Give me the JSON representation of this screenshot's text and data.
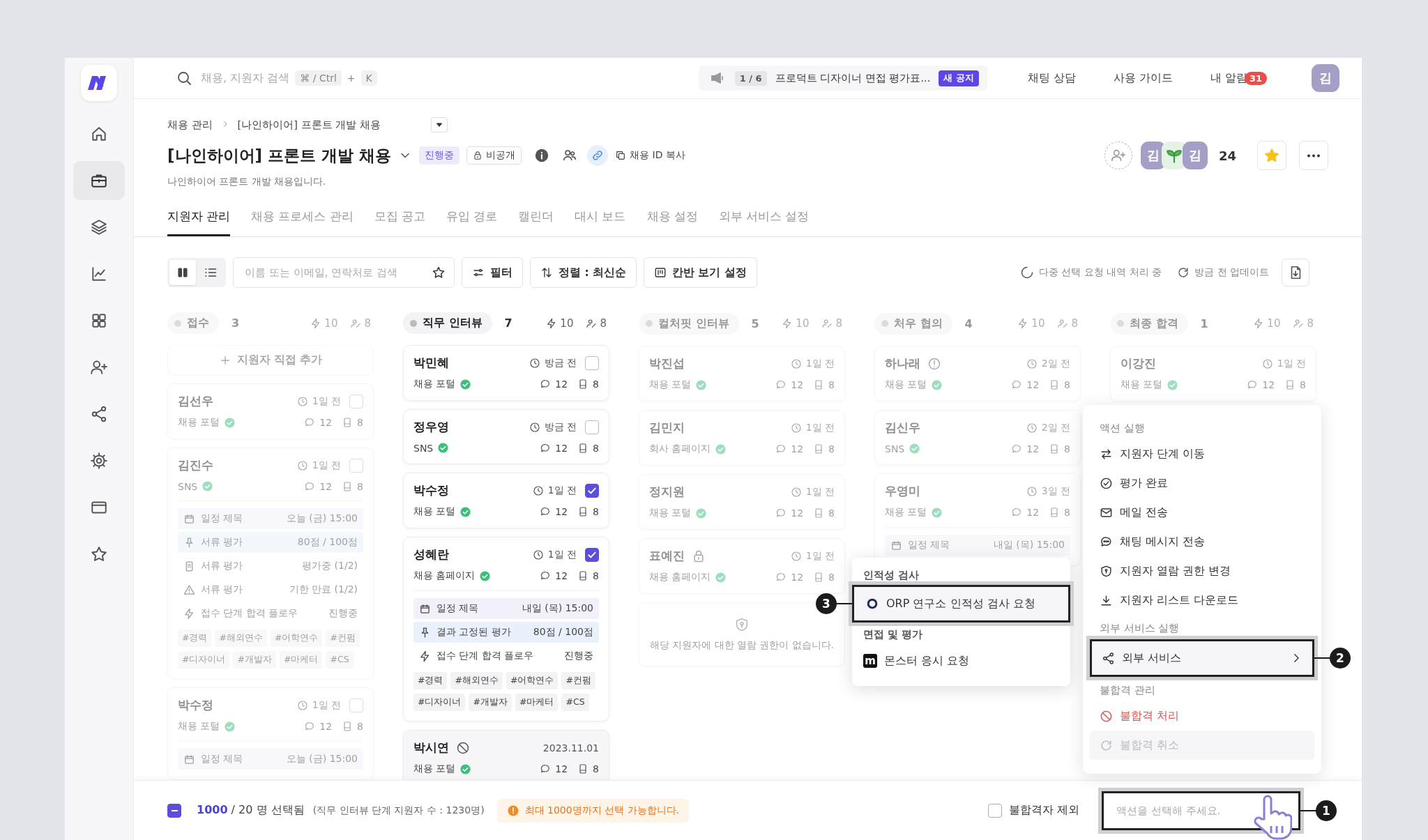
{
  "sidebar": {
    "items": [
      {
        "selected": false
      },
      {
        "selected": true
      },
      {
        "selected": false
      },
      {
        "selected": false
      },
      {
        "selected": false
      },
      {
        "selected": false
      },
      {
        "selected": false
      },
      {
        "selected": false
      },
      {
        "selected": false
      },
      {
        "selected": false
      }
    ]
  },
  "topbar": {
    "search_placeholder": "채용, 지원자 검색",
    "shortcut": [
      "⌘ / Ctrl",
      "+",
      "K"
    ],
    "notice": {
      "counter": "1 / 6",
      "text": "프로덕트 디자이너 면접 평가표...",
      "badge": "새 공지"
    },
    "links": [
      "채팅 상담",
      "사용 가이드"
    ],
    "notifications": {
      "label": "내 알림",
      "count": "31"
    },
    "avatar": "김"
  },
  "breadcrumb": [
    "채용 관리",
    "[나인하이어] 프론트 개발 채용"
  ],
  "title": "[나인하이어] 프론트 개발 채용",
  "status": "진행중",
  "visibility": "비공개",
  "copy_label": "채용 ID 복사",
  "description": "나인하이어 프론트 개발 채용입니다.",
  "members": [
    {
      "kind": "initial",
      "text": "김"
    },
    {
      "kind": "sprout"
    },
    {
      "kind": "initial",
      "text": "김"
    }
  ],
  "member_count": "24",
  "favorite": true,
  "tabs": [
    {
      "label": "지원자 관리",
      "selected": true
    },
    {
      "label": "채용 프로세스 관리",
      "selected": false
    },
    {
      "label": "모집 공고",
      "selected": false
    },
    {
      "label": "유입 경로",
      "selected": false
    },
    {
      "label": "캘린더",
      "selected": false
    },
    {
      "label": "대시 보드",
      "selected": false
    },
    {
      "label": "채용 설정",
      "selected": false
    },
    {
      "label": "외부 서비스 설정",
      "selected": false
    }
  ],
  "toolbar": {
    "views": [
      {
        "kind": "board",
        "selected": true
      },
      {
        "kind": "list",
        "selected": false
      }
    ],
    "search_placeholder": "이름 또는 이메일, 연락처로 검색",
    "buttons": [
      "필터",
      "정렬 : 최신순",
      "칸반 보기 설정"
    ],
    "processing": "다중 선택 요청 내역 처리 중",
    "updated": "방금 전 업데이트"
  },
  "columns": [
    {
      "name": "접수",
      "count": "3",
      "stat_a": "10",
      "stat_b": "8",
      "dimmed": true,
      "add_label": "지원자 직접 추가",
      "cards": [
        {
          "name": "김선우",
          "time": "1일 전",
          "clock": true,
          "checked": false,
          "source": "채용 포털",
          "comments": "12",
          "files": "8"
        },
        {
          "name": "김진수",
          "time": "1일 전",
          "clock": true,
          "checked": false,
          "source": "SNS",
          "comments": "12",
          "files": "8",
          "details": [
            {
              "kind": "schedule",
              "label": "일정 제목",
              "value": "오늘 (금) 15:00"
            },
            {
              "kind": "pinned",
              "label": "서류 평가",
              "value": "80점 / 100점"
            },
            {
              "kind": "document",
              "label": "서류 평가",
              "value": "평가중 (1/2)"
            },
            {
              "kind": "warning",
              "label": "서류 평가",
              "value": "기한 만료 (1/2)"
            },
            {
              "kind": "flow",
              "label": "접수 단계 합격 플로우",
              "value": "진행중"
            }
          ],
          "tags": [
            "#경력",
            "#해외연수",
            "#어학연수",
            "#컨펌",
            "#디자이너",
            "#개발자",
            "#마케터",
            "#CS"
          ]
        },
        {
          "name": "박수정",
          "time": "1일 전",
          "clock": true,
          "checked": false,
          "source": "채용 포털",
          "comments": "12",
          "files": "8",
          "details": [
            {
              "kind": "schedule",
              "label": "일정 제목",
              "value": "오늘 (금) 15:00"
            }
          ]
        }
      ]
    },
    {
      "name": "직무 인터뷰",
      "count": "7",
      "stat_a": "10",
      "stat_b": "8",
      "dimmed": false,
      "cards": [
        {
          "name": "박민혜",
          "time": "방금 전",
          "clock": true,
          "checked": false,
          "source": "채용 포털",
          "comments": "12",
          "files": "8"
        },
        {
          "name": "정우영",
          "time": "방금 전",
          "clock": true,
          "checked": false,
          "source": "SNS",
          "comments": "12",
          "files": "8"
        },
        {
          "name": "박수정",
          "time": "1일 전",
          "clock": true,
          "checked": true,
          "source": "채용 포털",
          "comments": "12",
          "files": "8"
        },
        {
          "name": "성혜란",
          "time": "1일 전",
          "clock": true,
          "checked": true,
          "source": "채용 홈페이지",
          "comments": "12",
          "files": "8",
          "details": [
            {
              "kind": "schedule",
              "label": "일정 제목",
              "value": "내일 (목) 15:00"
            },
            {
              "kind": "pinned",
              "label": "결과 고정된 평가",
              "value": "80점 / 100점"
            },
            {
              "kind": "flow",
              "label": "접수 단계 합격 플로우",
              "value": "진행중"
            }
          ],
          "tags": [
            "#경력",
            "#해외연수",
            "#어학연수",
            "#컨펌",
            "#디자이너",
            "#개발자",
            "#마케터",
            "#CS"
          ]
        },
        {
          "name": "박시연",
          "excluded": true,
          "time": "2023.11.01",
          "clock": false,
          "source": "채용 포털",
          "comments": "12",
          "files": "8"
        }
      ]
    },
    {
      "name": "컬처핏 인터뷰",
      "count": "5",
      "stat_a": "10",
      "stat_b": "8",
      "dimmed": true,
      "cards": [
        {
          "name": "박진섭",
          "time": "1일 전",
          "clock": true,
          "source": "채용 포털",
          "comments": "12",
          "files": "8"
        },
        {
          "name": "김민지",
          "time": "1일 전",
          "clock": true,
          "source": "회사 홈페이지",
          "comments": "12",
          "files": "8"
        },
        {
          "name": "정지원",
          "time": "1일 전",
          "clock": true,
          "source": "채용 포털",
          "comments": "12",
          "files": "8"
        },
        {
          "name": "표예진",
          "locked": true,
          "time": "1일 전",
          "clock": true,
          "source": "채용 홈페이지",
          "comments": "12",
          "files": "8"
        },
        {
          "kind": "restricted",
          "message": "해당 지원자에 대한 열람 권한이 없습니다."
        }
      ]
    },
    {
      "name": "처우 협의",
      "count": "4",
      "stat_a": "10",
      "stat_b": "8",
      "dimmed": true,
      "cards": [
        {
          "name": "하나래",
          "alert": true,
          "time": "2일 전",
          "clock": true,
          "source": "채용 포털",
          "comments": "12",
          "files": "8"
        },
        {
          "name": "김신우",
          "time": "2일 전",
          "clock": true,
          "source": "SNS",
          "comments": "12",
          "files": "8"
        },
        {
          "name": "우영미",
          "time": "3일 전",
          "clock": true,
          "source": "채용 포털",
          "comments": "12",
          "files": "8",
          "details": [
            {
              "kind": "schedule",
              "label": "일정 제목",
              "value": "내일 (목) 15:00"
            }
          ]
        }
      ]
    },
    {
      "name": "최종 합격",
      "count": "1",
      "stat_a": "10",
      "stat_b": "8",
      "dimmed": true,
      "cards": [
        {
          "name": "이강진",
          "time": "1일 전",
          "clock": true,
          "source": "채용 포털",
          "comments": "12",
          "files": "8"
        }
      ]
    }
  ],
  "action_menu": {
    "sections": [
      {
        "title": "액션 실행",
        "items": [
          {
            "label": "지원자 단계 이동"
          },
          {
            "label": "평가 완료"
          },
          {
            "label": "메일 전송"
          },
          {
            "label": "채팅 메시지 전송"
          },
          {
            "label": "지원자 열람 권한 변경"
          },
          {
            "label": "지원자 리스트 다운로드"
          }
        ]
      },
      {
        "title": "외부 서비스 실행",
        "items": [
          {
            "label": "외부 서비스",
            "submenu": true,
            "highlighted": true,
            "callout": "2"
          }
        ]
      },
      {
        "title": "불합격 관리",
        "items": [
          {
            "label": "불합격 처리",
            "danger": true
          },
          {
            "label": "불합격 취소",
            "disabled": true
          }
        ]
      }
    ]
  },
  "submenu": {
    "sections": [
      {
        "title": "인적성 검사",
        "items": [
          {
            "label": "ORP 연구소 인적성 검사 요청",
            "kind": "ring",
            "highlighted": true,
            "callout": "3"
          }
        ]
      },
      {
        "title": "면접 및 평가",
        "items": [
          {
            "label": "몬스터 응시 요청",
            "kind": "letter",
            "logo_text": "m",
            "highlighted": false
          }
        ]
      }
    ]
  },
  "bottom_bar": {
    "indeterminate": true,
    "selected": "**1000** / 20 명 선택됨",
    "note": "(직무 인터뷰 단계 지원자 수 : 1230명)",
    "warning": "최대 1000명까지 선택 가능합니다.",
    "exclude": {
      "label": "불합격자 제외",
      "checked": false
    },
    "action_select": {
      "placeholder": "액션을 선택해 주세요.",
      "highlighted": true,
      "callout": "1"
    }
  }
}
